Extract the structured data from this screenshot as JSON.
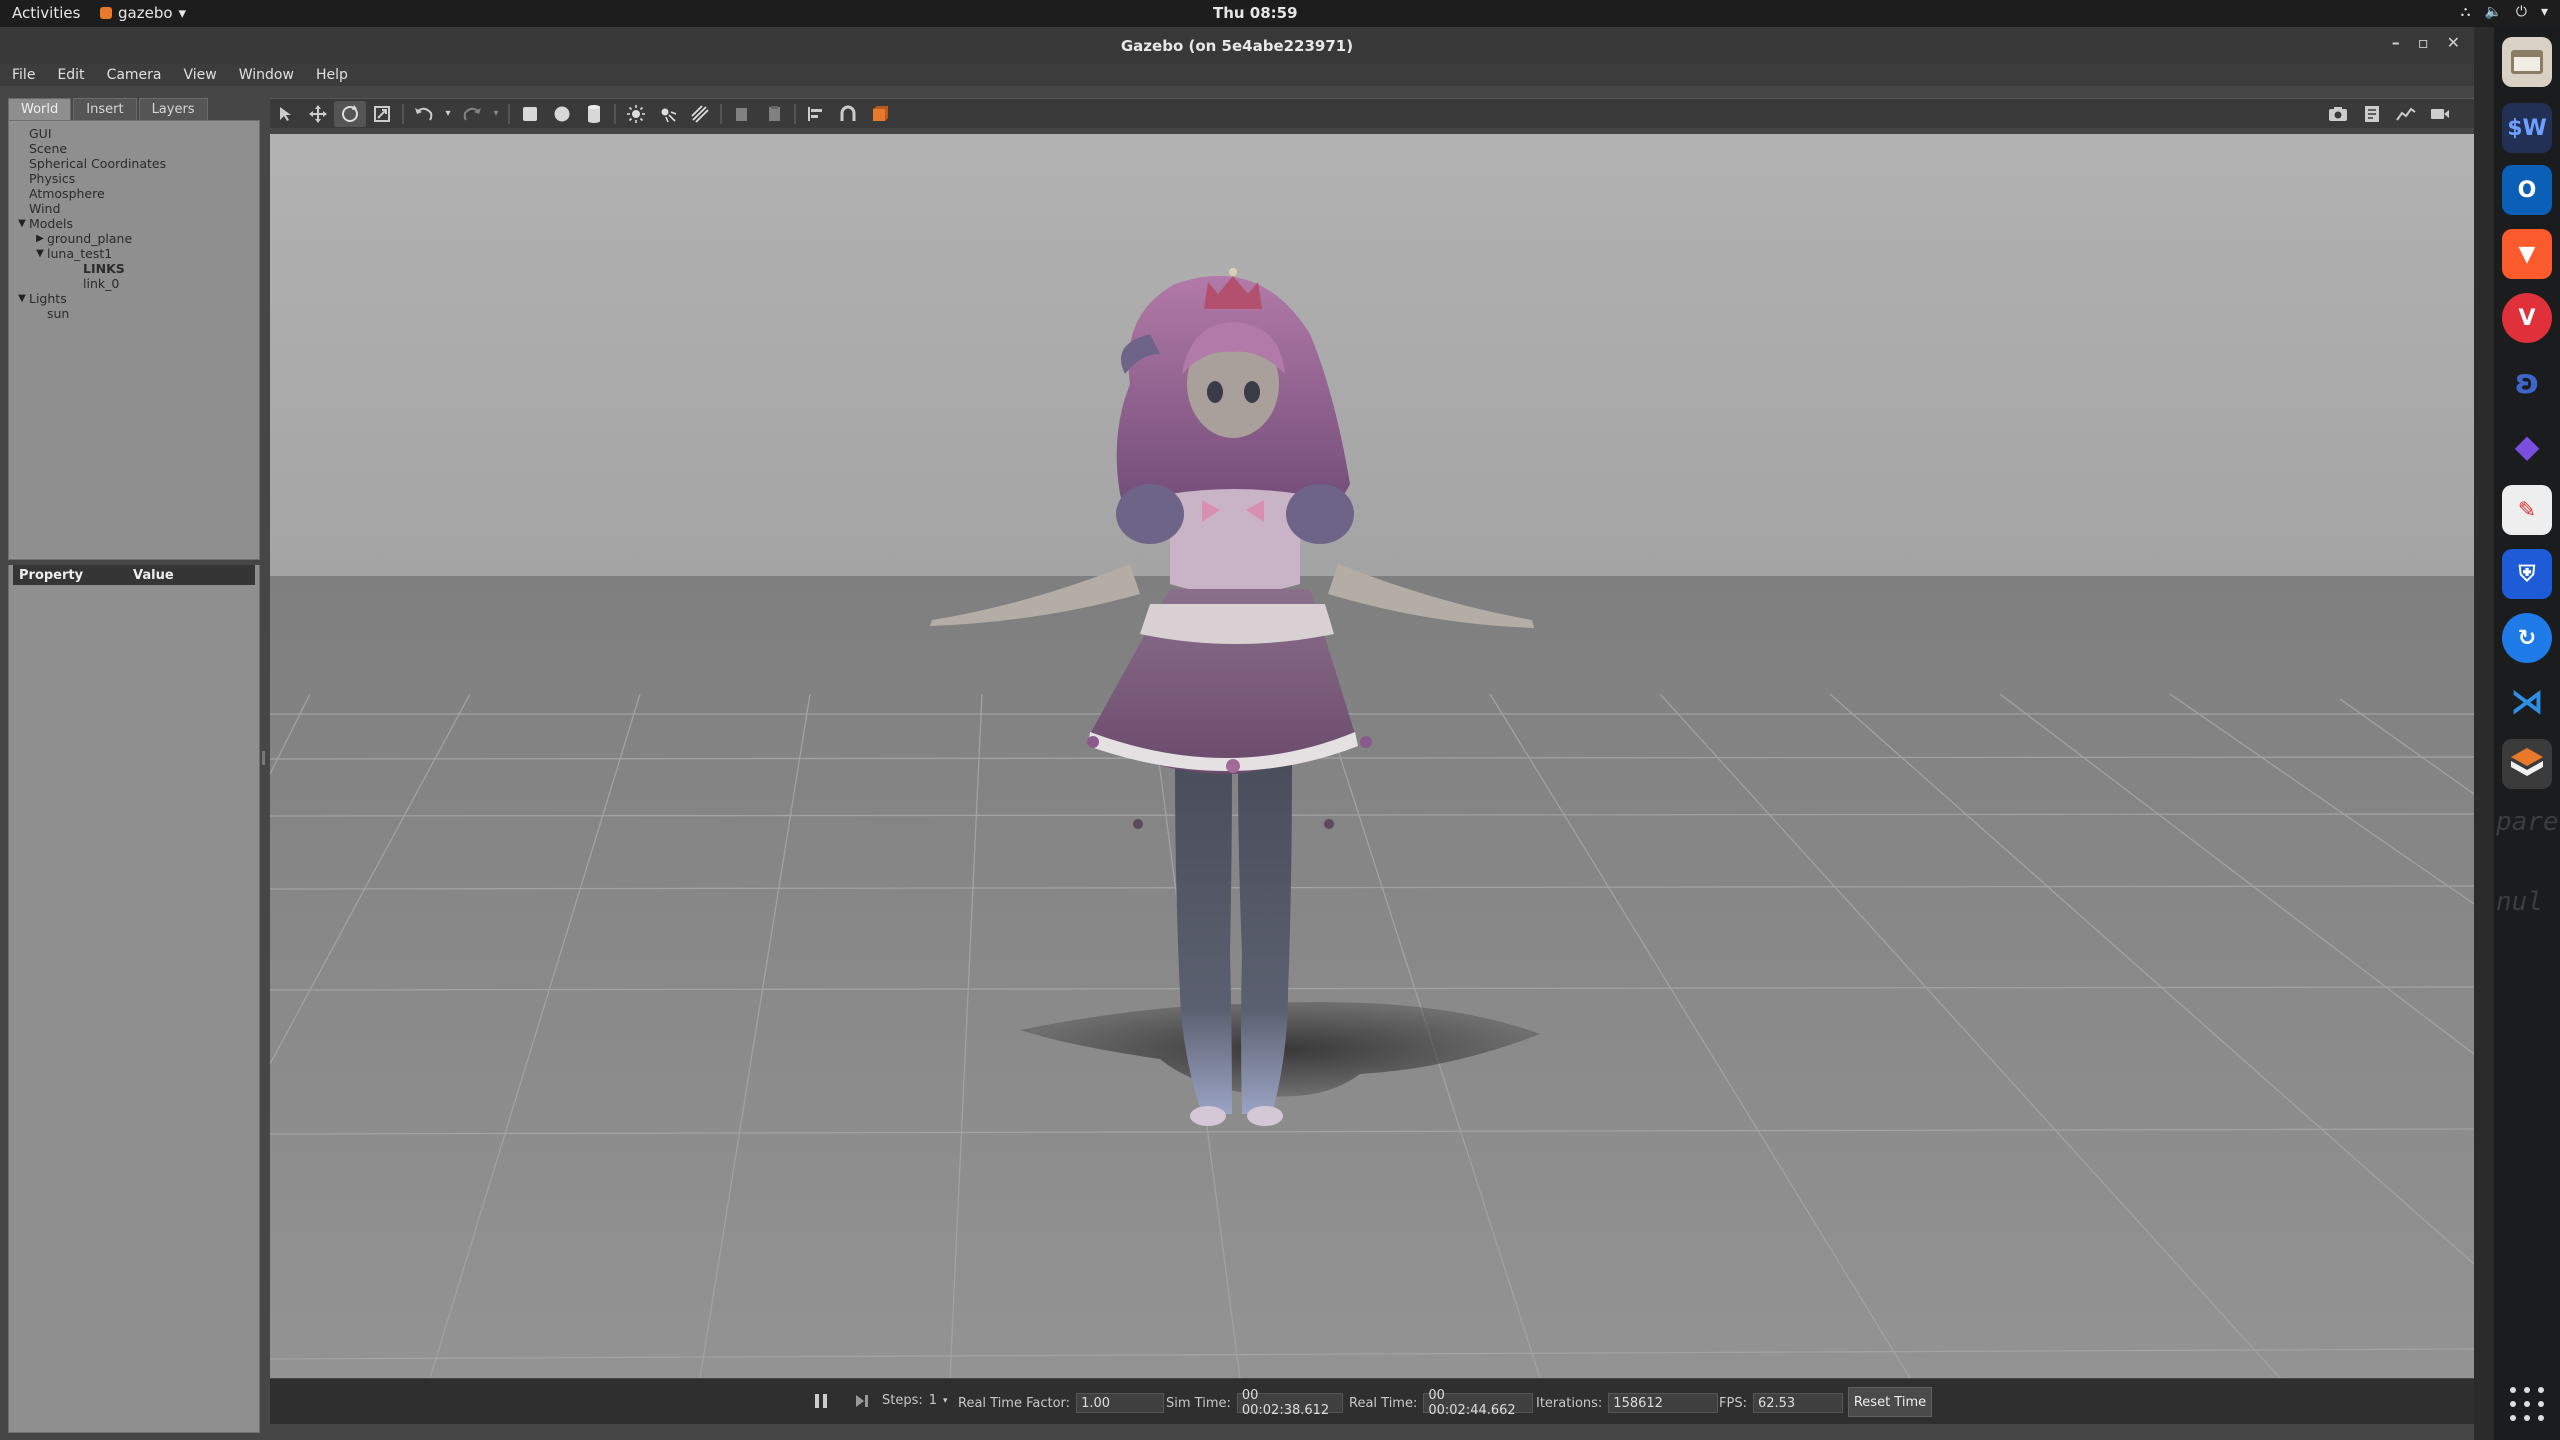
{
  "topbar": {
    "activities": "Activities",
    "app_name": "gazebo",
    "clock": "Thu 08:59"
  },
  "window": {
    "title": "Gazebo (on 5e4abe223971)"
  },
  "menubar": [
    "File",
    "Edit",
    "Camera",
    "View",
    "Window",
    "Help"
  ],
  "left_panel": {
    "tabs": [
      "World",
      "Insert",
      "Layers"
    ],
    "active_tab": "World",
    "tree": [
      {
        "label": "GUI",
        "indent": 0,
        "arrow": ""
      },
      {
        "label": "Scene",
        "indent": 0,
        "arrow": ""
      },
      {
        "label": "Spherical Coordinates",
        "indent": 0,
        "arrow": ""
      },
      {
        "label": "Physics",
        "indent": 0,
        "arrow": ""
      },
      {
        "label": "Atmosphere",
        "indent": 0,
        "arrow": ""
      },
      {
        "label": "Wind",
        "indent": 0,
        "arrow": ""
      },
      {
        "label": "Models",
        "indent": 0,
        "arrow": "down"
      },
      {
        "label": "ground_plane",
        "indent": 1,
        "arrow": "right"
      },
      {
        "label": "luna_test1",
        "indent": 1,
        "arrow": "down"
      },
      {
        "label": "LINKS",
        "indent": 3,
        "arrow": "",
        "bold": true
      },
      {
        "label": "link_0",
        "indent": 3,
        "arrow": ""
      },
      {
        "label": "Lights",
        "indent": 0,
        "arrow": "down"
      },
      {
        "label": "sun",
        "indent": 1,
        "arrow": ""
      }
    ],
    "property_header": "Property",
    "value_header": "Value"
  },
  "statusbar": {
    "steps_label": "Steps:",
    "steps_value": "1",
    "rtf_label": "Real Time Factor:",
    "rtf_value": "1.00",
    "sim_time_label": "Sim Time:",
    "sim_time_value": "00 00:02:38.612",
    "real_time_label": "Real Time:",
    "real_time_value": "00 00:02:44.662",
    "iterations_label": "Iterations:",
    "iterations_value": "158612",
    "fps_label": "FPS:",
    "fps_value": "62.53",
    "reset_time": "Reset Time"
  },
  "toolbar_icons": [
    "select-mode-icon",
    "translate-mode-icon",
    "rotate-mode-icon",
    "scale-mode-icon",
    "undo-icon",
    "redo-icon",
    "box-icon",
    "sphere-icon",
    "cylinder-icon",
    "point-light-icon",
    "spot-light-icon",
    "directional-light-icon",
    "copy-icon",
    "paste-icon",
    "align-icon",
    "snap-icon",
    "change-view-icon",
    "screenshot-icon",
    "log-icon",
    "plot-icon",
    "record-video-icon"
  ],
  "colors": {
    "accent_orange": "#e8782a",
    "sky": "#a9a9a9",
    "ground": "#8a8a8a"
  }
}
